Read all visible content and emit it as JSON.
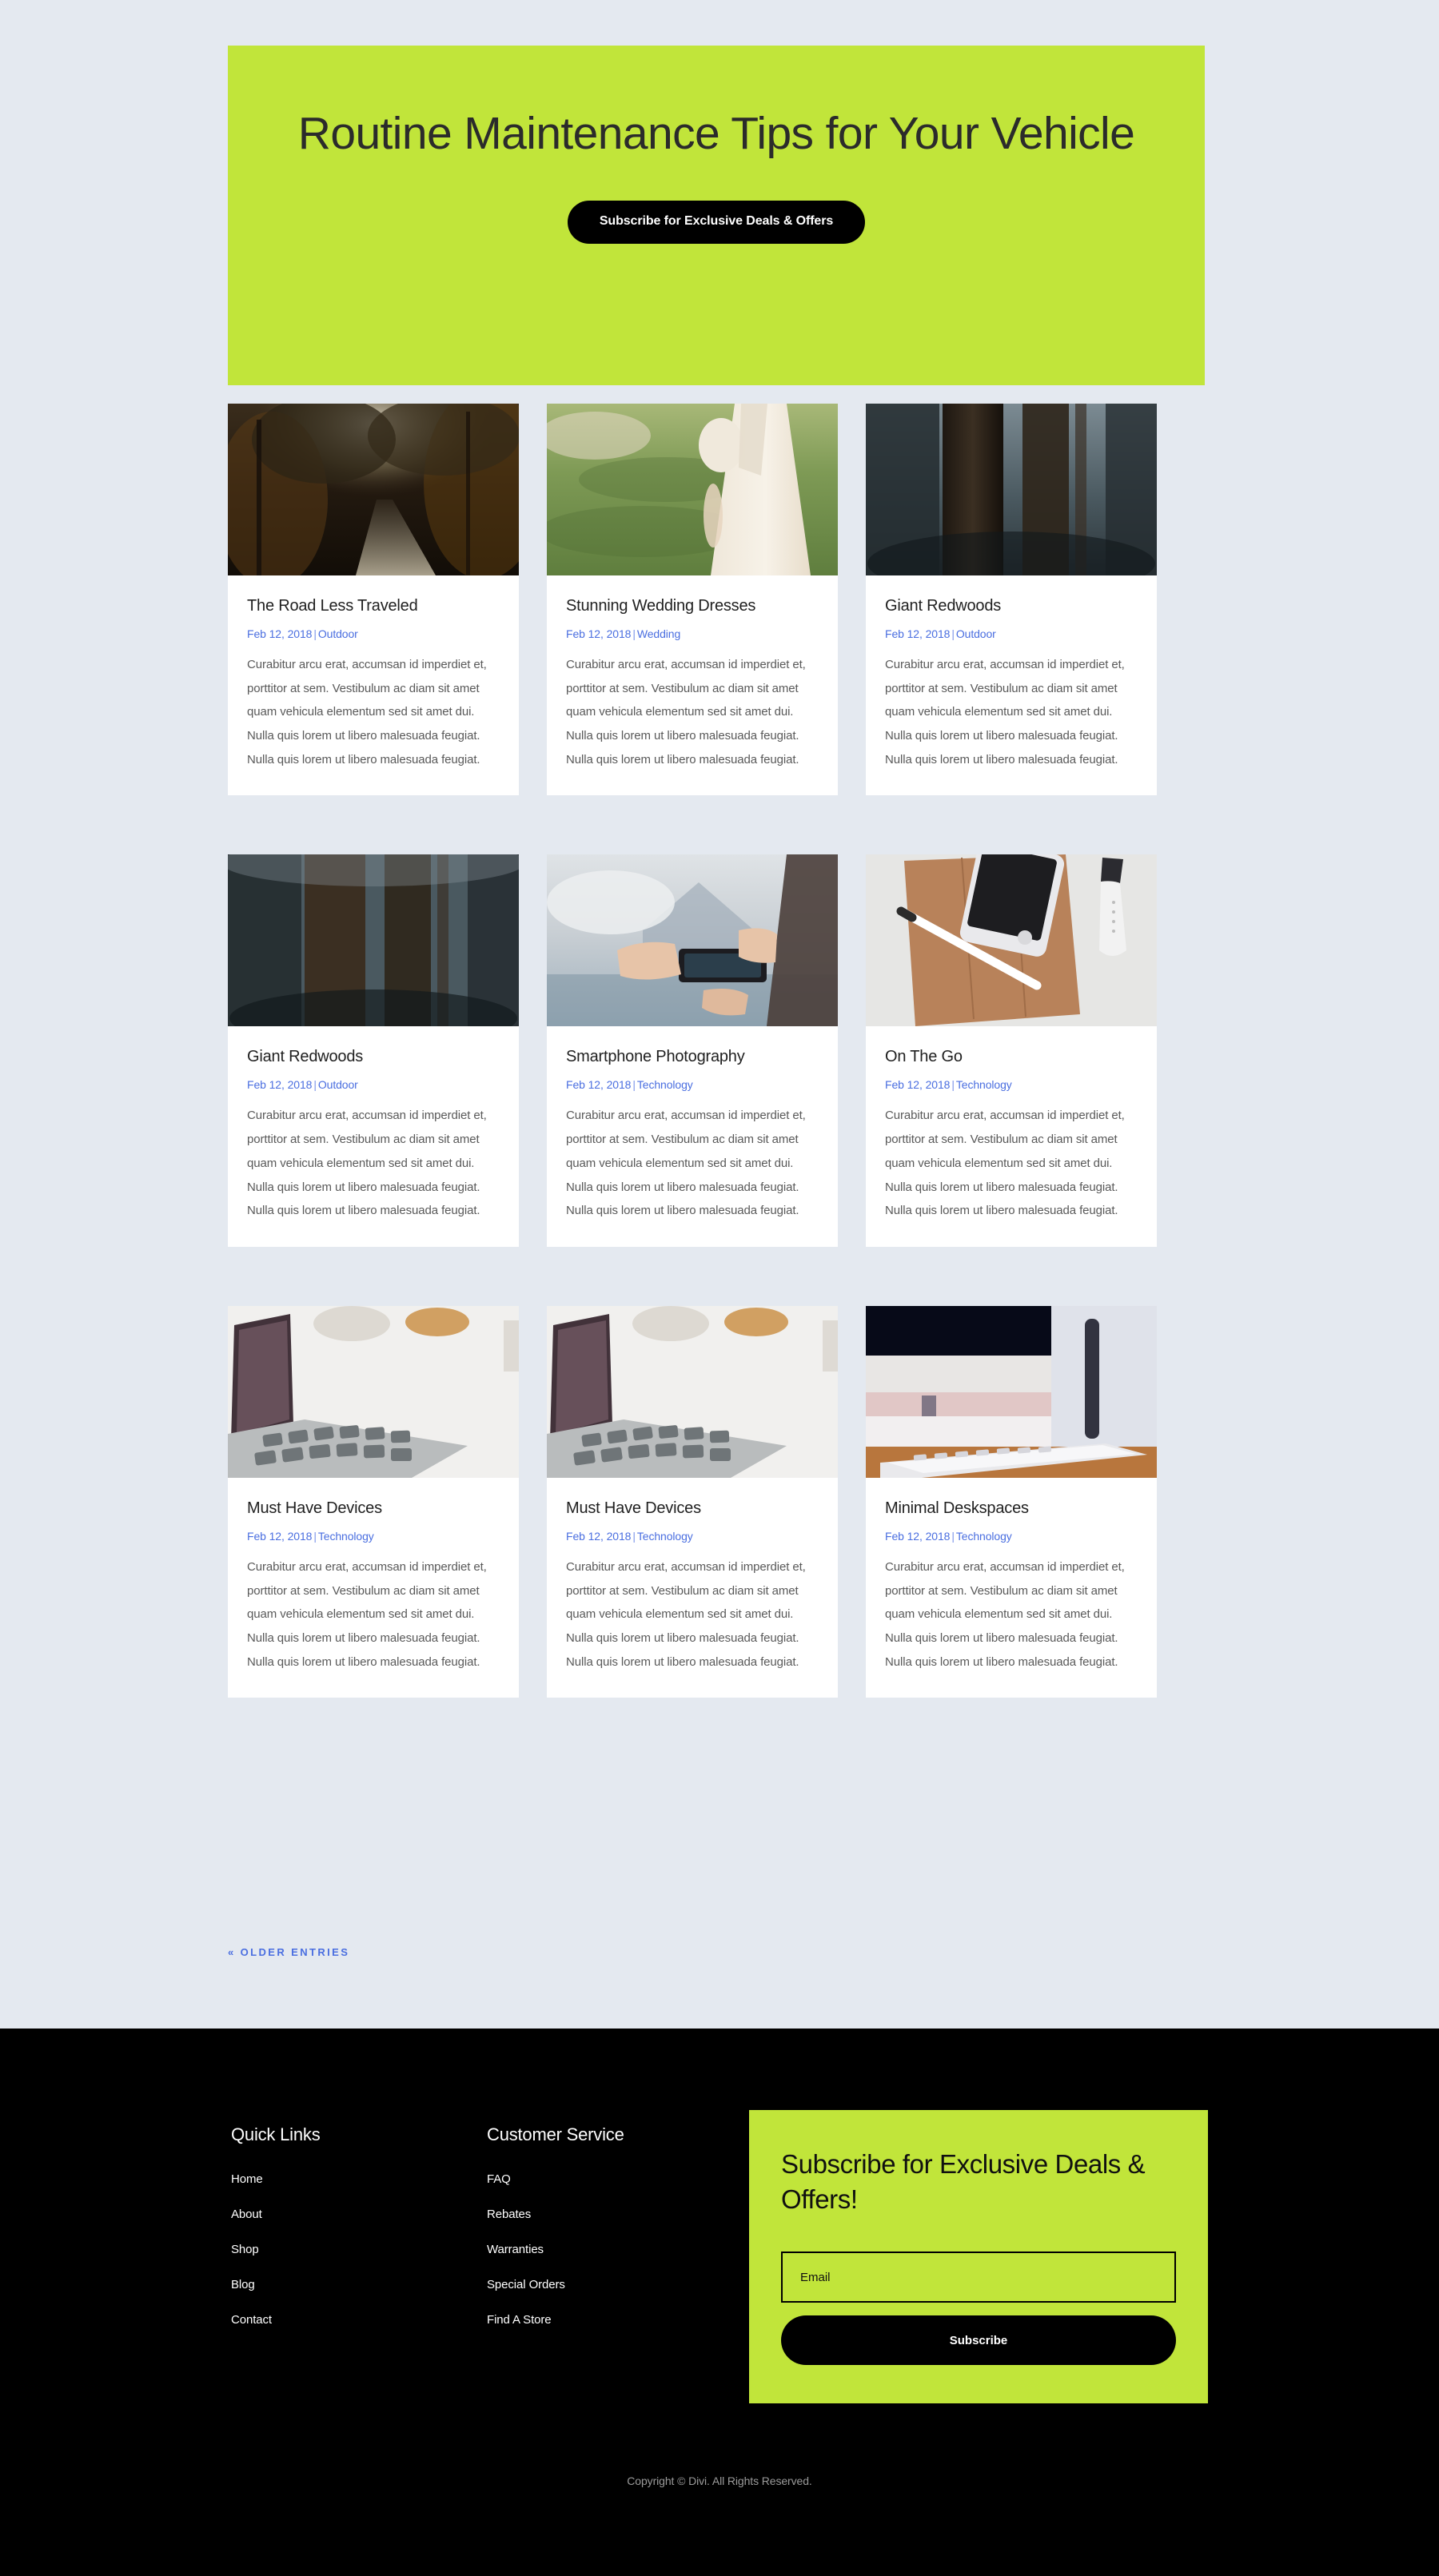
{
  "hero": {
    "title": "Routine Maintenance Tips for Your Vehicle",
    "cta_label": "Subscribe for Exclusive Deals & Offers"
  },
  "colors": {
    "accent_lime": "#c1e53a",
    "page_background": "#e4e9f0",
    "card_background": "#ffffff",
    "link_blue": "#4a6ee0",
    "footer_background": "#000000",
    "heading_text": "#1f1f1f",
    "body_text": "#595959"
  },
  "posts": [
    {
      "title": "The Road Less Traveled",
      "date": "Feb 12, 2018",
      "category": "Outdoor",
      "excerpt": "Curabitur arcu erat, accumsan id imperdiet et, porttitor at sem. Vestibulum ac diam sit amet quam vehicula elementum sed sit amet dui. Nulla quis lorem ut libero malesuada feugiat. Nulla quis lorem ut libero malesuada feugiat.",
      "image_name": "autumn-forest-road-photo"
    },
    {
      "title": "Stunning Wedding Dresses",
      "date": "Feb 12, 2018",
      "category": "Wedding",
      "excerpt": "Curabitur arcu erat, accumsan id imperdiet et, porttitor at sem. Vestibulum ac diam sit amet quam vehicula elementum sed sit amet dui. Nulla quis lorem ut libero malesuada feugiat. Nulla quis lorem ut libero malesuada feugiat.",
      "image_name": "bride-in-white-dress-on-grass-photo"
    },
    {
      "title": "Giant Redwoods",
      "date": "Feb 12, 2018",
      "category": "Outdoor",
      "excerpt": "Curabitur arcu erat, accumsan id imperdiet et, porttitor at sem. Vestibulum ac diam sit amet quam vehicula elementum sed sit amet dui. Nulla quis lorem ut libero malesuada feugiat. Nulla quis lorem ut libero malesuada feugiat.",
      "image_name": "redwood-tree-trunks-photo"
    },
    {
      "title": "Giant Redwoods",
      "date": "Feb 12, 2018",
      "category": "Outdoor",
      "excerpt": "Curabitur arcu erat, accumsan id imperdiet et, porttitor at sem. Vestibulum ac diam sit amet quam vehicula elementum sed sit amet dui. Nulla quis lorem ut libero malesuada feugiat. Nulla quis lorem ut libero malesuada feugiat.",
      "image_name": "redwood-tree-trunks-photo"
    },
    {
      "title": "Smartphone Photography",
      "date": "Feb 12, 2018",
      "category": "Technology",
      "excerpt": "Curabitur arcu erat, accumsan id imperdiet et, porttitor at sem. Vestibulum ac diam sit amet quam vehicula elementum sed sit amet dui. Nulla quis lorem ut libero malesuada feugiat. Nulla quis lorem ut libero malesuada feugiat.",
      "image_name": "hands-holding-phone-mountain-photo"
    },
    {
      "title": "On The Go",
      "date": "Feb 12, 2018",
      "category": "Technology",
      "excerpt": "Curabitur arcu erat, accumsan id imperdiet et, porttitor at sem. Vestibulum ac diam sit amet quam vehicula elementum sed sit amet dui. Nulla quis lorem ut libero malesuada feugiat. Nulla quis lorem ut libero malesuada feugiat.",
      "image_name": "phone-stylus-leather-case-photo"
    },
    {
      "title": "Must Have Devices",
      "date": "Feb 12, 2018",
      "category": "Technology",
      "excerpt": "Curabitur arcu erat, accumsan id imperdiet et, porttitor at sem. Vestibulum ac diam sit amet quam vehicula elementum sed sit amet dui. Nulla quis lorem ut libero malesuada feugiat. Nulla quis lorem ut libero malesuada feugiat.",
      "image_name": "laptop-on-white-desk-photo"
    },
    {
      "title": "Must Have Devices",
      "date": "Feb 12, 2018",
      "category": "Technology",
      "excerpt": "Curabitur arcu erat, accumsan id imperdiet et, porttitor at sem. Vestibulum ac diam sit amet quam vehicula elementum sed sit amet dui. Nulla quis lorem ut libero malesuada feugiat. Nulla quis lorem ut libero malesuada feugiat.",
      "image_name": "laptop-on-white-desk-photo"
    },
    {
      "title": "Minimal Deskspaces",
      "date": "Feb 12, 2018",
      "category": "Technology",
      "excerpt": "Curabitur arcu erat, accumsan id imperdiet et, porttitor at sem. Vestibulum ac diam sit amet quam vehicula elementum sed sit amet dui. Nulla quis lorem ut libero malesuada feugiat. Nulla quis lorem ut libero malesuada feugiat.",
      "image_name": "wireless-keyboard-desk-photo"
    }
  ],
  "pagination": {
    "older_entries_label": "« Older Entries"
  },
  "footer": {
    "quick_links": {
      "heading": "Quick Links",
      "items": [
        "Home",
        "About",
        "Shop",
        "Blog",
        "Contact"
      ]
    },
    "customer_service": {
      "heading": "Customer Service",
      "items": [
        "FAQ",
        "Rebates",
        "Warranties",
        "Special Orders",
        "Find A Store"
      ]
    },
    "subscribe": {
      "title": "Subscribe for Exclusive Deals & Offers!",
      "email_placeholder": "Email",
      "email_value": "",
      "button_label": "Subscribe"
    },
    "copyright": "Copyright © Divi. All Rights Reserved."
  }
}
